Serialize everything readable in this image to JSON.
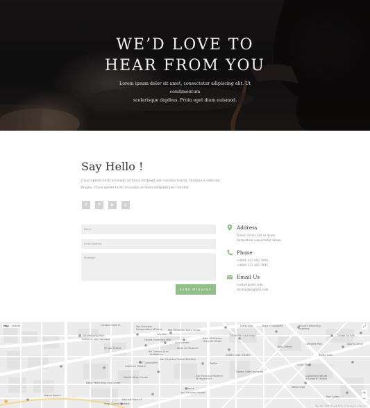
{
  "hero": {
    "title_line1": "WE’D LOVE TO",
    "title_line2": "HEAR FROM YOU",
    "subtitle_line1": "Lorem ipsum dolor sit amet, consectetur adipiscing elit. Ut condimentum",
    "subtitle_line2": "scelerisque dapibus. Proin eget diam euismod."
  },
  "hello": {
    "title": "Say Hello !",
    "text_line1": "Class aptent taciti sociosqu ad litora torquent per conubia nostra. Quisque a vehicula",
    "text_line2": "magna. Class aptent taciti sociosqu ad litora torquent per conubia.",
    "socials": [
      {
        "icon": "facebook-icon",
        "glyph": "f"
      },
      {
        "icon": "pinterest-icon",
        "glyph": "P"
      },
      {
        "icon": "youtube-icon",
        "glyph": "▶"
      },
      {
        "icon": "instagram-icon",
        "glyph": "◎"
      }
    ]
  },
  "form": {
    "name_placeholder": "Name",
    "email_placeholder": "Email Address",
    "message_placeholder": "Message",
    "send_label": "SEND MESSAGE"
  },
  "contact": {
    "address_title": "Address",
    "address_line1": "Donec varius nisl in quam",
    "address_line2": "fermentum consectetur ullam.",
    "phone_title": "Phone",
    "phone_line1": "+4800 123 456 7890",
    "phone_line2": "+4800 123 456 7890",
    "email_title": "Email Us",
    "email_line1": "contact@divi.com",
    "email_line2": "divimade@gmail.com",
    "accent_color": "#8fbe86"
  },
  "map": {
    "labels": [
      {
        "text": "Creative Hotel Pr",
        "name": "map-label-creative-hotel"
      },
      {
        "text": "International High",
        "name": "map-label-intl-high"
      },
      {
        "text": "School of San Francisco",
        "name": "map-label-intl-high-2"
      },
      {
        "text": "SF Jazz Center",
        "name": "map-label-sf-jazz"
      },
      {
        "text": "San Francisco",
        "name": "map-label-sf-conservatory"
      },
      {
        "text": "Conservatory of Music",
        "name": "map-label-sf-conservatory-2"
      },
      {
        "text": "Davies Symphony Hall",
        "name": "map-label-davies"
      },
      {
        "text": "War Memorial Opera House",
        "name": "map-label-opera"
      },
      {
        "text": "Asian Art Museum",
        "name": "map-label-asian-art"
      },
      {
        "text": "City Hall",
        "name": "map-label-city-hall"
      },
      {
        "text": "Bill Graham Civic",
        "name": "map-label-bill-graham"
      },
      {
        "text": "Auditorium",
        "name": "map-label-bill-graham-2"
      },
      {
        "text": "Civic Center",
        "name": "map-label-civic-center"
      },
      {
        "text": "San Francisco Federal Building",
        "name": "map-label-federal"
      },
      {
        "text": "Twitter",
        "name": "map-label-twitter"
      },
      {
        "text": "Golden Gate Theatre",
        "name": "map-label-ggt"
      },
      {
        "text": "Orpheum Theatre",
        "name": "map-label-orpheum"
      },
      {
        "text": "PAC Corporation",
        "name": "map-label-pac"
      },
      {
        "text": "Market Street Center",
        "name": "map-label-market-street"
      },
      {
        "text": "Ballet Performing Arts Center",
        "name": "map-label-ballet"
      },
      {
        "text": "Alamo Square",
        "name": "map-label-alamo"
      },
      {
        "text": "Marriott Hotel SF",
        "name": "map-label-marriott"
      },
      {
        "text": "Yerba Buena Gardens",
        "name": "map-label-yerba"
      },
      {
        "text": "San Francisco Museum",
        "name": "map-label-sfmoma"
      },
      {
        "text": "of Modern Art",
        "name": "map-label-sfmoma-2"
      },
      {
        "text": "Bank of America",
        "name": "map-label-boa"
      },
      {
        "text": "Financial Center",
        "name": "map-label-boa-2"
      },
      {
        "text": "Sparta",
        "name": "map-label-sparta"
      },
      {
        "text": "San Francisco Herald",
        "name": "map-label-herald"
      },
      {
        "text": "Golden Gate University",
        "name": "map-label-ggu"
      },
      {
        "text": "Lafayette Park",
        "name": "map-label-lafayette"
      },
      {
        "text": "Center for Arts",
        "name": "map-label-center-arts"
      },
      {
        "text": "Union Plaza",
        "name": "map-label-union-plaza"
      },
      {
        "text": "California Institute",
        "name": "map-label-caltech"
      },
      {
        "text": "of Integral Studies",
        "name": "map-label-caltech-2"
      },
      {
        "text": "Dolby Labs",
        "name": "map-label-dolby"
      },
      {
        "text": "Wells Fargo",
        "name": "map-label-wells"
      },
      {
        "text": "Adams Elementary",
        "name": "map-label-adams"
      },
      {
        "text": "Academy",
        "name": "map-label-adams-2"
      },
      {
        "text": "NOPA Parking Garage",
        "name": "map-label-nopa"
      },
      {
        "text": "Bank + Lafayette",
        "name": "map-label-bank-lafayette"
      },
      {
        "text": "Lofts Hotel",
        "name": "map-label-lofts"
      },
      {
        "text": "Ross Gallery",
        "name": "map-label-ross"
      },
      {
        "text": "Sports Center",
        "name": "map-label-sports"
      },
      {
        "text": "Park Safety",
        "name": "map-label-park-safety"
      }
    ],
    "type_map": "Map",
    "type_satellite": "Satellite",
    "attribution": "Map data ©2023 Google   Terms of Use   Report a map error",
    "zoom_in": "+",
    "zoom_out": "−",
    "fullscreen": "⤢"
  }
}
